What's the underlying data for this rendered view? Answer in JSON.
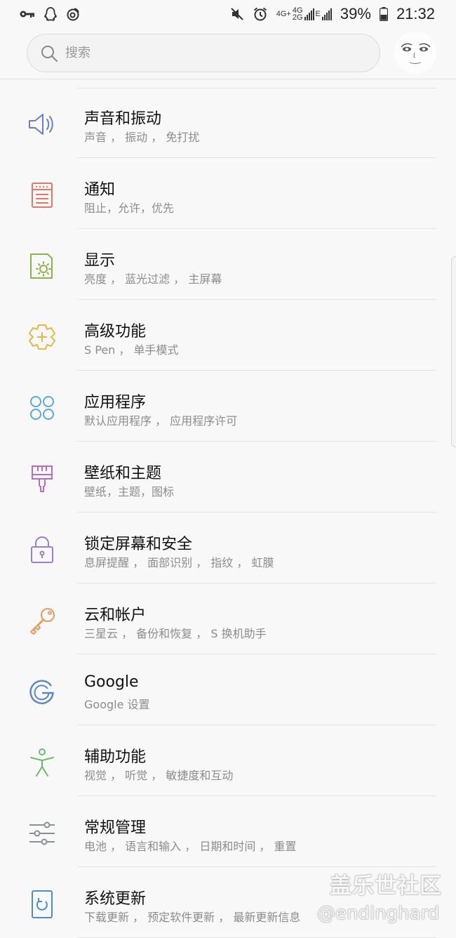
{
  "status_bar": {
    "battery_percent": "39%",
    "time": "21:32",
    "network_top": "4G+",
    "network_bottom": "4G",
    "network_bottom2": "2G",
    "network_e": "E",
    "left_icons": [
      "key-icon",
      "qq-icon",
      "weibo-icon"
    ],
    "right_icons": [
      "mute-icon",
      "alarm-icon",
      "signal-icon",
      "battery-icon"
    ]
  },
  "search": {
    "placeholder": "搜索"
  },
  "settings": [
    {
      "title": "声音和振动",
      "subtitle": "声音 ， 振动 ， 免打扰",
      "icon": "speaker-icon",
      "color": "#6a7fc4"
    },
    {
      "title": "通知",
      "subtitle": "阻止，允许，优先",
      "icon": "notification-icon",
      "color": "#e2786a"
    },
    {
      "title": "显示",
      "subtitle": "亮度 ， 蓝光过滤 ， 主屏幕",
      "icon": "display-icon",
      "color": "#8ab34a"
    },
    {
      "title": "高级功能",
      "subtitle": "S Pen ， 单手模式",
      "icon": "advanced-features-icon",
      "color": "#e8b84a"
    },
    {
      "title": "应用程序",
      "subtitle": "默认应用程序 ， 应用程序许可",
      "icon": "apps-icon",
      "color": "#5aa9d6"
    },
    {
      "title": "壁纸和主题",
      "subtitle": "壁纸，主题，图标",
      "icon": "brush-icon",
      "color": "#b96cc4"
    },
    {
      "title": "锁定屏幕和安全",
      "subtitle": "息屏提醒 ， 面部识别 ， 指纹 ， 虹膜",
      "icon": "lock-icon",
      "color": "#9a7fd0"
    },
    {
      "title": "云和帐户",
      "subtitle": "三星云 ， 备份和恢复 ， S 换机助手",
      "icon": "key-icon",
      "color": "#e89a5e"
    },
    {
      "title": "Google",
      "subtitle": "Google 设置",
      "icon": "google-icon",
      "color": "#5b86c8"
    },
    {
      "title": "辅助功能",
      "subtitle": "视觉 ， 听觉 ， 敏捷度和互动",
      "icon": "accessibility-icon",
      "color": "#6dbb6a"
    },
    {
      "title": "常规管理",
      "subtitle": "电池 ， 语言和输入 ， 日期和时间 ， 重置",
      "icon": "sliders-icon",
      "color": "#8a8f96"
    },
    {
      "title": "系统更新",
      "subtitle": "下载更新 ， 预定软件更新 ， 最新更新信息",
      "icon": "system-update-icon",
      "color": "#4a8fd0"
    }
  ],
  "watermark": {
    "line1": "盖乐世社区",
    "line2": "@endinghard"
  }
}
